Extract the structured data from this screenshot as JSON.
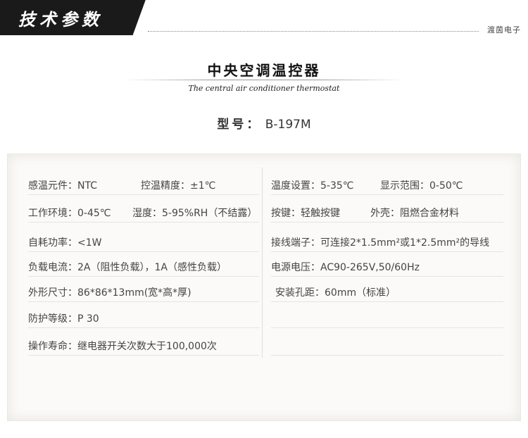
{
  "header": {
    "section_title": "技术参数",
    "brand": "渡茵电子"
  },
  "product": {
    "title": "中央空调温控器",
    "subtitle": "The central air conditioner thermostat",
    "model_label": "型号：",
    "model_value": "B-197M"
  },
  "specs": {
    "left": [
      {
        "a": "感温元件：NTC",
        "b": "控温精度：±1℃"
      },
      {
        "a": "工作环境：0-45℃",
        "b": "湿度：5-95%RH（不结露）"
      },
      {
        "a": "自耗功率：<1W",
        "b": ""
      },
      {
        "a": "负载电流：2A（阻性负载），1A（感性负载）",
        "b": ""
      },
      {
        "a": "外形尺寸：86*86*13mm(宽*高*厚)",
        "b": ""
      },
      {
        "a": "防护等级：P 30",
        "b": ""
      },
      {
        "a": "操作寿命：继电器开关次数大于100,000次",
        "b": ""
      }
    ],
    "right": [
      {
        "a": "温度设置：5-35℃",
        "b": "显示范围：0-50℃"
      },
      {
        "a": "按键：轻触按键",
        "b": "外壳：阻燃合金材料"
      },
      {
        "a": "接线端子：可连接2*1.5mm²或1*2.5mm²的导线",
        "b": ""
      },
      {
        "a": "电源电压：AC90-265V,50/60Hz",
        "b": ""
      },
      {
        "a": "安装孔距：60mm（标准）",
        "b": ""
      }
    ]
  }
}
